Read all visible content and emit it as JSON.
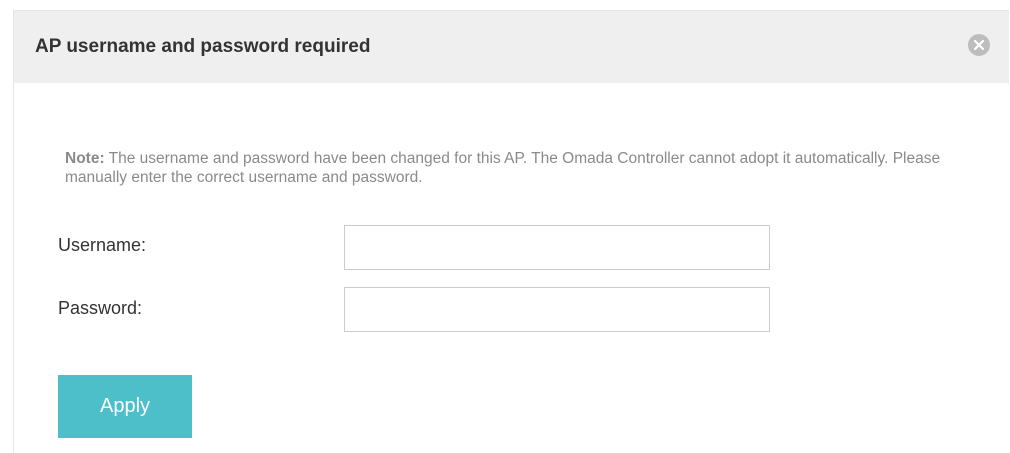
{
  "dialog": {
    "title": "AP username and password required",
    "close_icon": "close-icon"
  },
  "note": {
    "prefix": "Note:",
    "text": " The username and password have been changed for this AP. The Omada Controller cannot adopt it automatically. Please manually enter the correct username and password."
  },
  "form": {
    "username_label": "Username:",
    "username_value": "",
    "password_label": "Password:",
    "password_value": ""
  },
  "actions": {
    "apply_label": "Apply"
  },
  "colors": {
    "header_bg": "#efefef",
    "accent": "#4cbfc9",
    "note_text": "#8a8a8a",
    "close_icon_bg": "#bdbdbd"
  }
}
